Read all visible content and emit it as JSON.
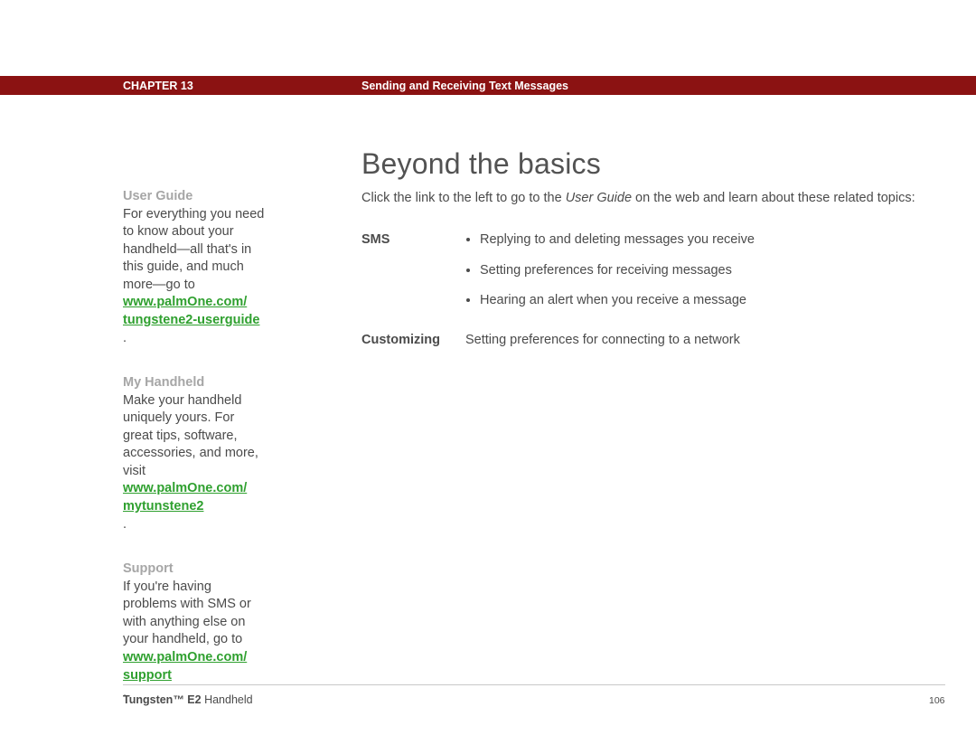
{
  "header": {
    "chapter": "CHAPTER 13",
    "section": "Sending and Receiving Text Messages"
  },
  "main": {
    "title": "Beyond the basics",
    "intro_prefix": "Click the link to the left to go to the ",
    "intro_em": "User Guide",
    "intro_suffix": " on the web and learn about these related topics:",
    "topics": {
      "sms_label": "SMS",
      "sms_items": [
        "Replying to and deleting messages you receive",
        "Setting preferences for receiving messages",
        "Hearing an alert when you receive a message"
      ],
      "customizing_label": "Customizing",
      "customizing_text": "Setting preferences for connecting to a network"
    }
  },
  "sidebar": {
    "user_guide": {
      "head": "User Guide",
      "body": "For everything you need to know about your handheld—all that's in this guide, and much more—go to ",
      "link1": "www.palmOne.com/",
      "link2": "tungstene2-userguide"
    },
    "my_handheld": {
      "head": "My Handheld",
      "body": "Make your handheld uniquely yours. For great tips, software, accessories, and more, visit ",
      "link1": "www.palmOne.com/",
      "link2": "mytunstene2"
    },
    "support": {
      "head": "Support",
      "body": "If you're having problems with SMS or with anything else on your handheld, go to ",
      "link1": "www.palmOne.com/",
      "link2": "support"
    }
  },
  "footer": {
    "product_bold": "Tungsten™ E2",
    "product_rest": " Handheld",
    "page": "106"
  }
}
